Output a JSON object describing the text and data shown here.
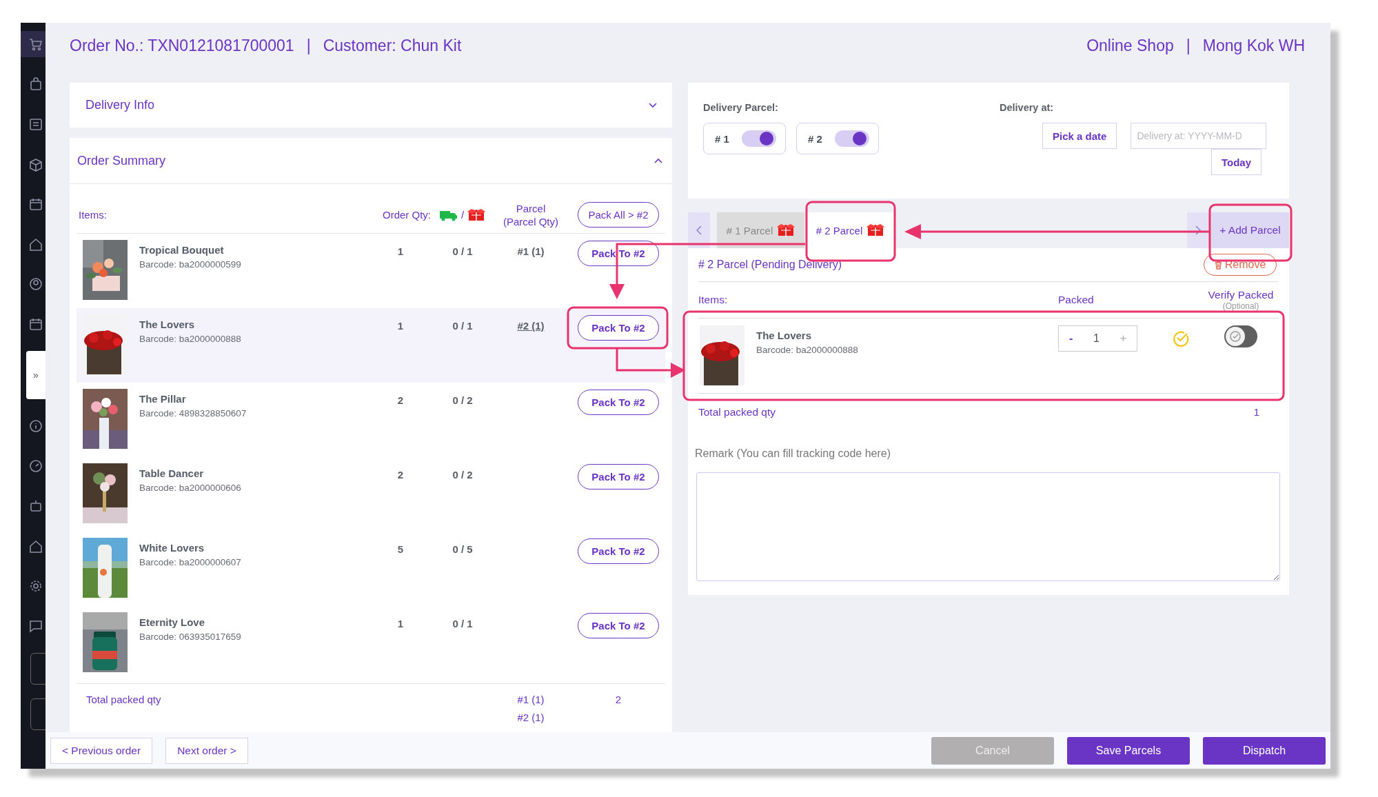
{
  "sidebar": {
    "items": [
      {
        "selected": true
      },
      {
        "selected": false
      },
      {
        "selected": false
      },
      {
        "selected": false
      },
      {
        "selected": false
      },
      {
        "selected": false
      },
      {
        "selected": false
      },
      {
        "selected": false
      },
      {
        "selected": false
      },
      {
        "selected": false
      },
      {
        "selected": false
      },
      {
        "selected": false
      },
      {
        "selected": false
      },
      {
        "selected": false
      }
    ],
    "toggle": "»"
  },
  "header": {
    "left": [
      "Order No.: TXN0121081700001",
      "|",
      "Customer: Chun Kit"
    ],
    "right": [
      "Online Shop",
      "|",
      "Mong Kok WH"
    ]
  },
  "delivery_info": {
    "title": "Delivery Info",
    "expanded": false
  },
  "order_summary": {
    "title": "Order Summary",
    "expanded": true,
    "columns": {
      "items": "Items:",
      "order_qty": "Order Qty:",
      "slash": "/",
      "parcel": "Parcel",
      "parcel_qty": "(Parcel Qty)",
      "pack_all": "Pack All > #2"
    },
    "rows": [
      {
        "name": "Tropical Bouquet",
        "barcode": "Barcode: ba2000000599",
        "qty": "1",
        "progress": "0 / 1",
        "parcel": "#1 (1)",
        "parcel_link": false,
        "action": "Pack To #2",
        "selected": false
      },
      {
        "name": "The Lovers",
        "barcode": "Barcode: ba2000000888",
        "qty": "1",
        "progress": "0 / 1",
        "parcel": "#2 (1)",
        "parcel_link": true,
        "action": "Pack To #2",
        "selected": true
      },
      {
        "name": "The Pillar",
        "barcode": "Barcode: 4898328850607",
        "qty": "2",
        "progress": "0 / 2",
        "action": "Pack To #2",
        "selected": false
      },
      {
        "name": "Table Dancer",
        "barcode": "Barcode: ba2000000606",
        "qty": "2",
        "progress": "0 / 2",
        "action": "Pack To #2",
        "selected": false
      },
      {
        "name": "White Lovers",
        "barcode": "Barcode: ba2000000607",
        "qty": "5",
        "progress": "0 / 5",
        "action": "Pack To #2",
        "selected": false
      },
      {
        "name": "Eternity Love",
        "barcode": "Barcode: 063935017659",
        "qty": "1",
        "progress": "0 / 1",
        "action": "Pack To #2",
        "selected": false
      }
    ],
    "total": {
      "label": "Total packed qty",
      "parcels": [
        "#1 (1)",
        "#2 (1)"
      ],
      "value": "2"
    }
  },
  "delivery": {
    "parcel_label": "Delivery Parcel:",
    "toggles": [
      {
        "label": "# 1",
        "on": true
      },
      {
        "label": "# 2",
        "on": true
      }
    ],
    "at_label": "Delivery at:",
    "pick_button": "Pick a date",
    "date_placeholder": "Delivery at: YYYY-MM-D",
    "today_button": "Today"
  },
  "parcel_tabs": [
    {
      "label": "# 1 Parcel",
      "selected": false
    },
    {
      "label": "# 2 Parcel",
      "selected": true
    }
  ],
  "add_parcel": "+ Add Parcel",
  "parcel": {
    "title": "# 2 Parcel (Pending Delivery)",
    "remove": "Remove",
    "items_header": "Items:",
    "packed_header": "Packed",
    "verify_header": "Verify Packed",
    "verify_note": "(Optional)",
    "items": [
      {
        "name": "The Lovers",
        "barcode": "Barcode: ba2000000888",
        "minus": "-",
        "packed": "1",
        "plus": "+",
        "verified": true,
        "verify_on": false
      }
    ],
    "total_label": "Total packed qty",
    "total_value": "1",
    "remark_label": "Remark (You can fill tracking code here)"
  },
  "footer": {
    "previous": "< Previous order",
    "next": "Next order >",
    "buttons": [
      {
        "label": "Cancel",
        "disabled": true
      },
      {
        "label": "Save Parcels",
        "disabled": false
      },
      {
        "label": "Dispatch",
        "disabled": false
      }
    ]
  }
}
